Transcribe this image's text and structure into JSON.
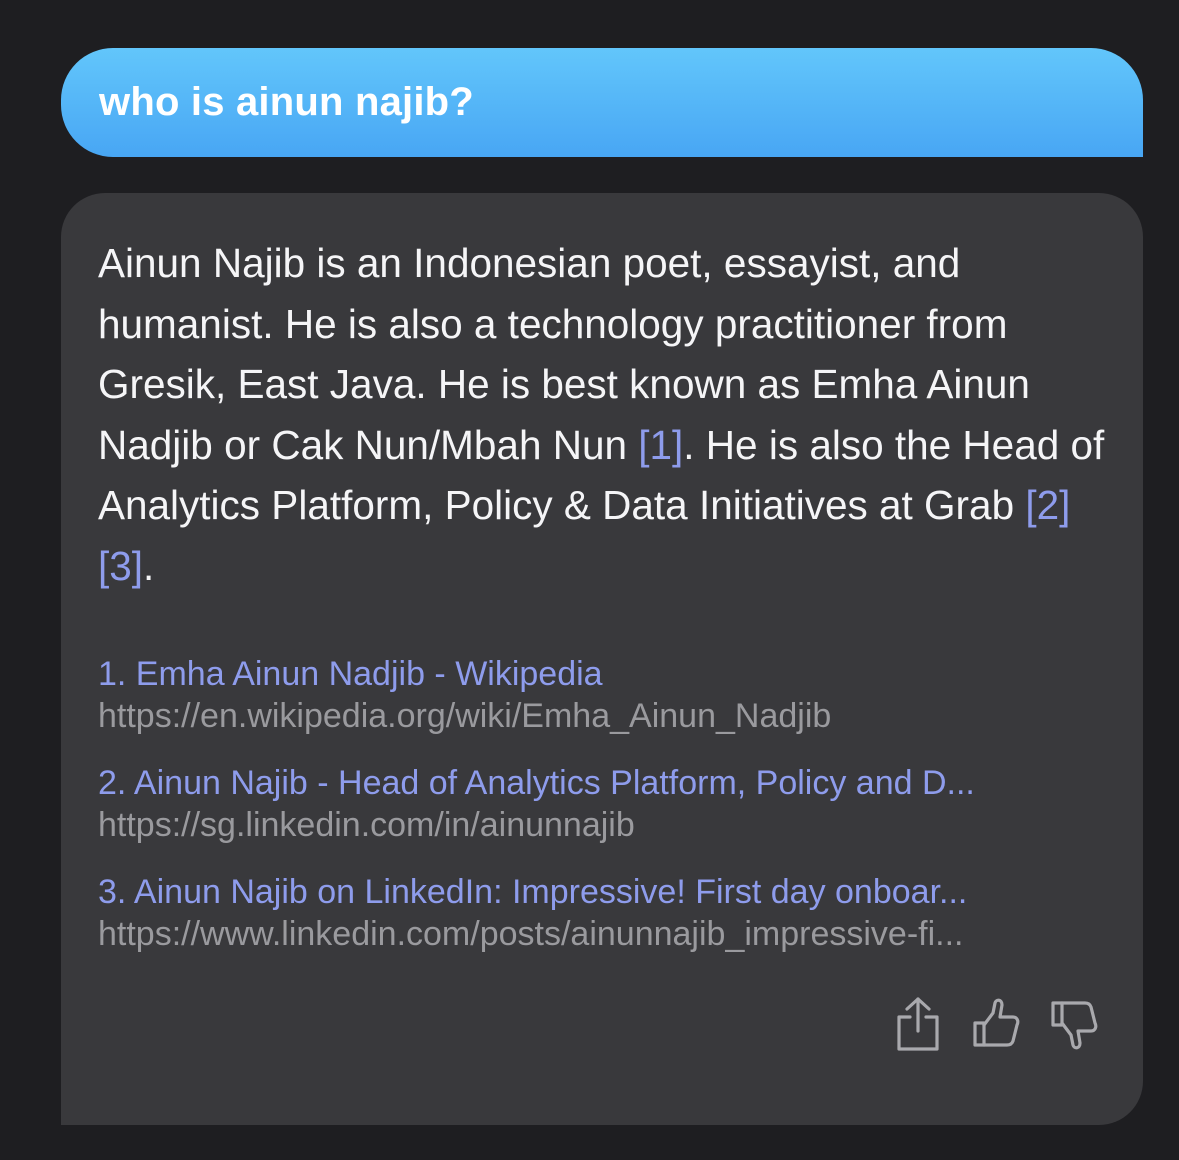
{
  "user_message": {
    "text": "who is ainun najib?"
  },
  "assistant_message": {
    "segments": [
      {
        "text": "Ainun Najib is an Indonesian poet, essayist, and humanist. He is also a technology practitioner from Gresik, East Java. He is best known as Emha Ainun Nadjib or Cak Nun/Mbah Nun ",
        "cite": false
      },
      {
        "text": "[1]",
        "cite": true
      },
      {
        "text": ". He is also the Head of Analytics Platform, Policy & Data Initiatives at Grab ",
        "cite": false
      },
      {
        "text": "[2]",
        "cite": true
      },
      {
        "text": "[3]",
        "cite": true
      },
      {
        "text": ".",
        "cite": false
      }
    ],
    "sources": [
      {
        "title": "1. Emha Ainun Nadjib - Wikipedia",
        "url": "https://en.wikipedia.org/wiki/Emha_Ainun_Nadjib"
      },
      {
        "title": "2. Ainun Najib - Head of Analytics Platform, Policy and D...",
        "url": "https://sg.linkedin.com/in/ainunnajib"
      },
      {
        "title": "3. Ainun Najib on LinkedIn: Impressive! First day onboar...",
        "url": "https://www.linkedin.com/posts/ainunnajib_impressive-fi..."
      }
    ],
    "actions": {
      "share_icon": "share-icon",
      "thumbs_up_icon": "thumbs-up-icon",
      "thumbs_down_icon": "thumbs-down-icon"
    }
  },
  "colors": {
    "background": "#1e1e21",
    "user_bubble": "#48a6f4",
    "assistant_bubble": "#39393c",
    "citation": "#8e9cec",
    "url": "#9a9a9e"
  }
}
